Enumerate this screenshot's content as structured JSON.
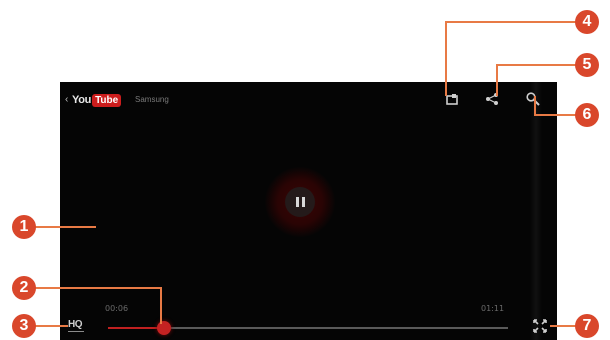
{
  "player": {
    "app_logo_you": "You",
    "app_logo_tube": "Tube",
    "channel": "Samsung",
    "time_elapsed": "00:06",
    "time_total": "01:11",
    "hq_label": "HQ",
    "progress": 0.14
  },
  "callouts": [
    "1",
    "2",
    "3",
    "4",
    "5",
    "6",
    "7"
  ],
  "colors": {
    "accent": "#d9472b",
    "leader": "#e87a45",
    "scrubber": "#c42222",
    "screen": "#050505"
  },
  "icons": {
    "back": "chevron-left-icon",
    "rotate": "screen-rotate-icon",
    "share": "share-icon",
    "search": "search-icon",
    "pause": "pause-icon",
    "fullscreen": "fullscreen-icon"
  }
}
